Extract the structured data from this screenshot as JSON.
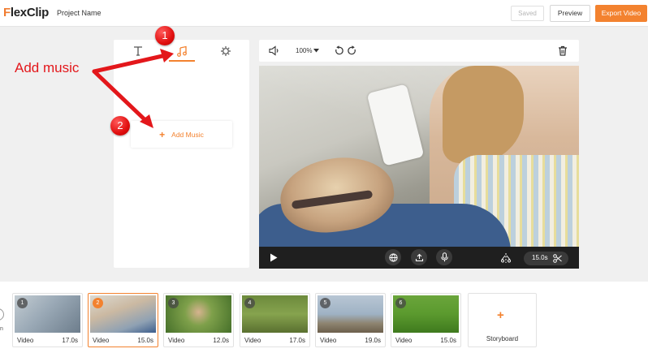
{
  "header": {
    "logo": "FlexClip",
    "project_name": "Project Name",
    "saved_label": "Saved",
    "preview_label": "Preview",
    "export_label": "Export Video"
  },
  "panel": {
    "tabs": [
      {
        "icon": "text-icon"
      },
      {
        "icon": "music-note-icon",
        "active": true
      },
      {
        "icon": "settings-gear-icon"
      }
    ],
    "add_music_label": "Add Music"
  },
  "annotations": {
    "callout_label": "Add music",
    "badge_1": "1",
    "badge_2": "2"
  },
  "video_toolbar": {
    "zoom": "100%",
    "icons": [
      "volume-icon",
      "chevron-down-icon",
      "undo-icon",
      "redo-icon",
      "trash-icon"
    ]
  },
  "player": {
    "duration": "15.0s",
    "icons": [
      "play-icon",
      "globe-icon",
      "upload-icon",
      "microphone-icon",
      "split-icon",
      "scissors-icon"
    ]
  },
  "timeline": {
    "clips": [
      {
        "num": "1",
        "kind": "Video",
        "duration": "17.0s"
      },
      {
        "num": "2",
        "kind": "Video",
        "duration": "15.0s"
      },
      {
        "num": "3",
        "kind": "Video",
        "duration": "12.0s"
      },
      {
        "num": "4",
        "kind": "Video",
        "duration": "17.0s"
      },
      {
        "num": "5",
        "kind": "Video",
        "duration": "19.0s"
      },
      {
        "num": "6",
        "kind": "Video",
        "duration": "15.0s"
      }
    ],
    "storyboard_label": "Storyboard",
    "edge_letter": "n"
  },
  "colors": {
    "accent": "#f3822f",
    "annotation_red": "#e3171b",
    "player_bar": "#1f1f1f"
  }
}
